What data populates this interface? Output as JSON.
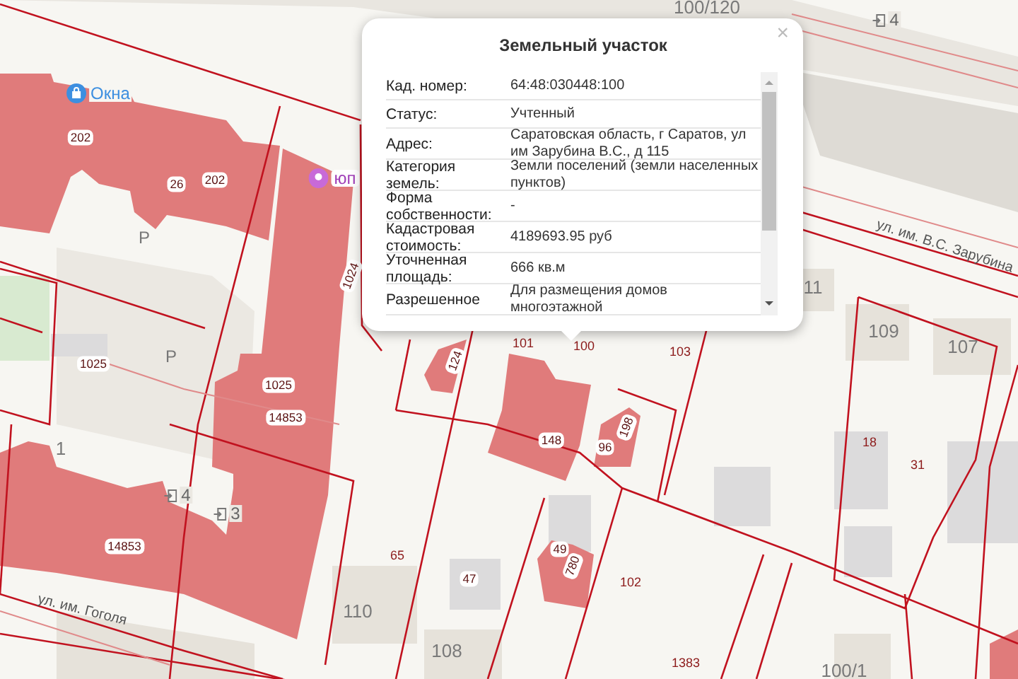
{
  "map_labels": [
    {
      "kind": "tag",
      "text": "202"
    },
    {
      "kind": "tag",
      "text": "26"
    },
    {
      "kind": "tag",
      "text": "202"
    },
    {
      "kind": "tag",
      "text": "1024"
    },
    {
      "kind": "tag",
      "text": "1025"
    },
    {
      "kind": "tag",
      "text": "1025"
    },
    {
      "kind": "tag",
      "text": "14853"
    },
    {
      "kind": "tag",
      "text": "14853"
    },
    {
      "kind": "house",
      "text": "1"
    },
    {
      "kind": "entrance",
      "text": "4"
    },
    {
      "kind": "entrance",
      "text": "3"
    },
    {
      "kind": "parcel",
      "text": "65"
    },
    {
      "kind": "tag",
      "text": "47"
    },
    {
      "kind": "house",
      "text": "110"
    },
    {
      "kind": "house",
      "text": "108"
    },
    {
      "kind": "tag",
      "text": "124"
    },
    {
      "kind": "parcel",
      "text": "101"
    },
    {
      "kind": "parcel",
      "text": "100"
    },
    {
      "kind": "parcel",
      "text": "103"
    },
    {
      "kind": "tag",
      "text": "148"
    },
    {
      "kind": "tag",
      "text": "96"
    },
    {
      "kind": "tag",
      "text": "198"
    },
    {
      "kind": "tag",
      "text": "49"
    },
    {
      "kind": "tag",
      "text": "780"
    },
    {
      "kind": "parcel",
      "text": "102"
    },
    {
      "kind": "parcel",
      "text": "1383"
    },
    {
      "kind": "parcel",
      "text": "18"
    },
    {
      "kind": "parcel",
      "text": "31"
    },
    {
      "kind": "house",
      "text": "11"
    },
    {
      "kind": "house",
      "text": "109"
    },
    {
      "kind": "house",
      "text": "107"
    },
    {
      "kind": "house",
      "text": "100/1"
    },
    {
      "kind": "house",
      "text": "100/120"
    },
    {
      "kind": "entrance",
      "text": "4"
    },
    {
      "kind": "parking",
      "text": "P"
    },
    {
      "kind": "parking",
      "text": "P"
    },
    {
      "kind": "street",
      "text": "ул. им. Гоголя"
    },
    {
      "kind": "street",
      "text": "ул. им. В.С. Зарубина"
    },
    {
      "kind": "shop",
      "text": "Окна"
    },
    {
      "kind": "place",
      "text": "юп"
    }
  ],
  "popup": {
    "title": "Земельный участок",
    "close": "×",
    "rows": [
      {
        "label": "Кад. номер:",
        "value": "64:48:030448:100"
      },
      {
        "label": "Статус:",
        "value": "Учтенный"
      },
      {
        "label": "Адрес:",
        "value": "Саратовская область, г Саратов, ул им Зарубина В.С., д 115"
      },
      {
        "label": "Категория земель:",
        "value": "Земли поселений (земли населенных пунктов)"
      },
      {
        "label": "Форма собственности:",
        "value": "-"
      },
      {
        "label": "Кадастровая стоимость:",
        "value": "4189693.95 руб"
      },
      {
        "label": "Уточненная площадь:",
        "value": "666 кв.м"
      },
      {
        "label": "Разрешенное",
        "value": "Для размещения домов многоэтажной"
      }
    ]
  }
}
